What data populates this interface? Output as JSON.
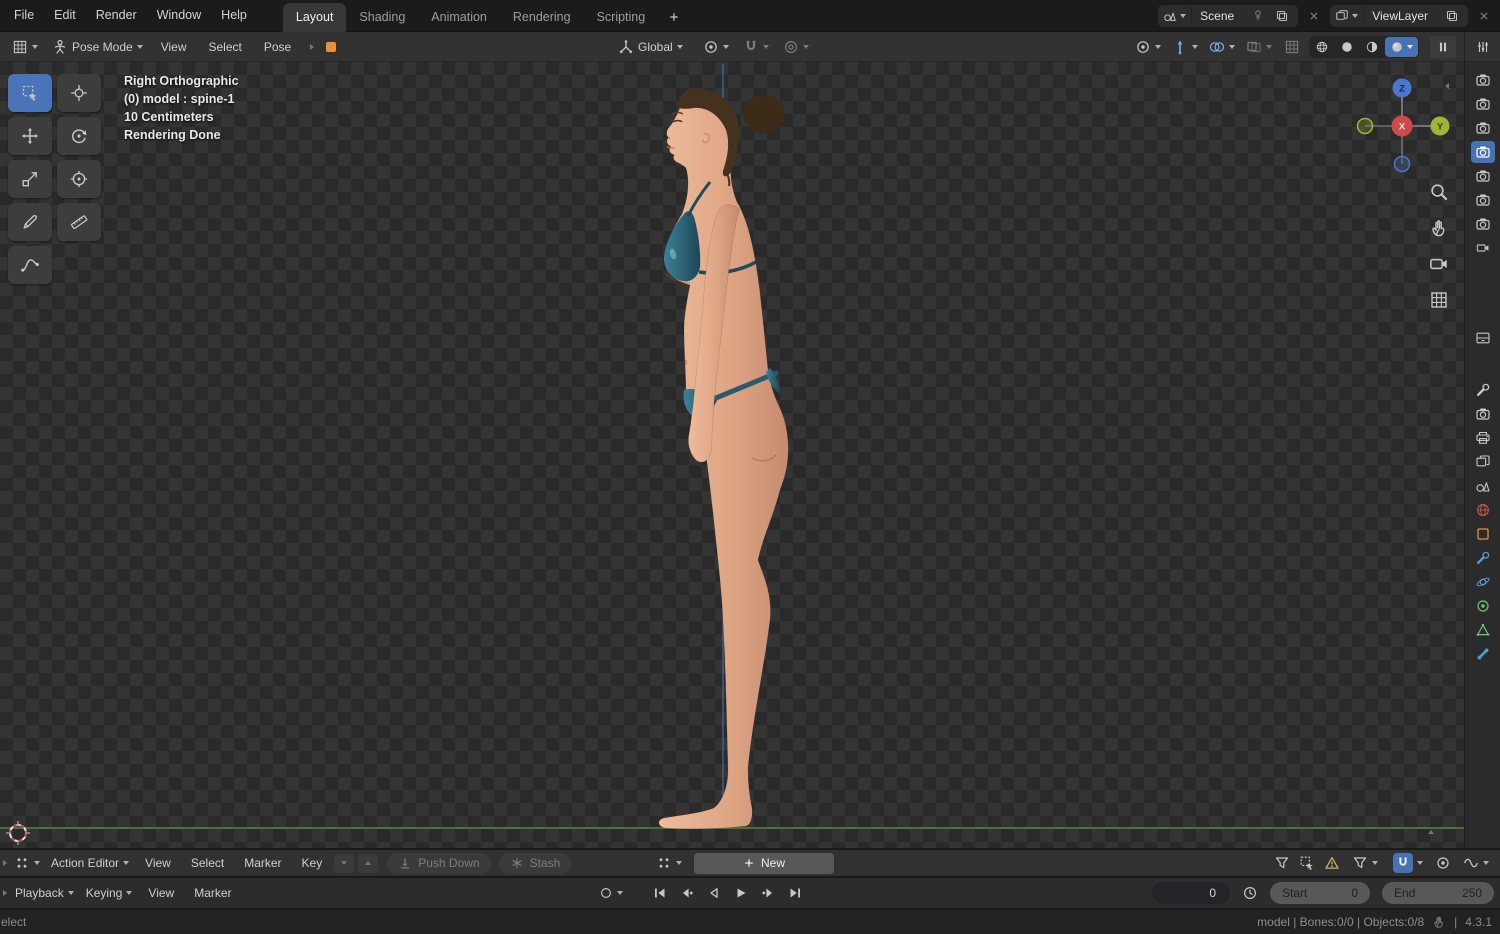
{
  "colors": {
    "accent": "#4772b3",
    "object_orange": "#e8913c"
  },
  "topbar": {
    "menus": [
      "File",
      "Edit",
      "Render",
      "Window",
      "Help"
    ],
    "workspaces": [
      "Layout",
      "Shading",
      "Animation",
      "Rendering",
      "Scripting"
    ],
    "active_workspace": "Layout",
    "scene": {
      "label": "Scene"
    },
    "viewlayer": {
      "label": "ViewLayer"
    }
  },
  "viewport": {
    "header": {
      "mode": "Pose Mode",
      "menus": [
        "View",
        "Select",
        "Pose"
      ],
      "orientation": "Global"
    },
    "overlay": {
      "lines": [
        "Right Orthographic",
        "(0) model : spine-1",
        "10 Centimeters",
        "Rendering Done"
      ]
    },
    "gizmo": {
      "z": "Z",
      "x": "X",
      "y": "Y"
    }
  },
  "dopesheet": {
    "editor": "Action Editor",
    "menus": [
      "View",
      "Select",
      "Marker",
      "Key"
    ],
    "push_down": "Push Down",
    "stash": "Stash",
    "new": "New"
  },
  "timeline": {
    "playback": "Playback",
    "keying": "Keying",
    "menus": [
      "View",
      "Marker"
    ],
    "current_frame": "0",
    "start_label": "Start",
    "start_value": "0",
    "end_label": "End",
    "end_value": "250"
  },
  "statusbar": {
    "left": "elect",
    "info": "model | Bones:0/0 | Objects:0/8",
    "separator": "|",
    "version": "4.3.1"
  }
}
